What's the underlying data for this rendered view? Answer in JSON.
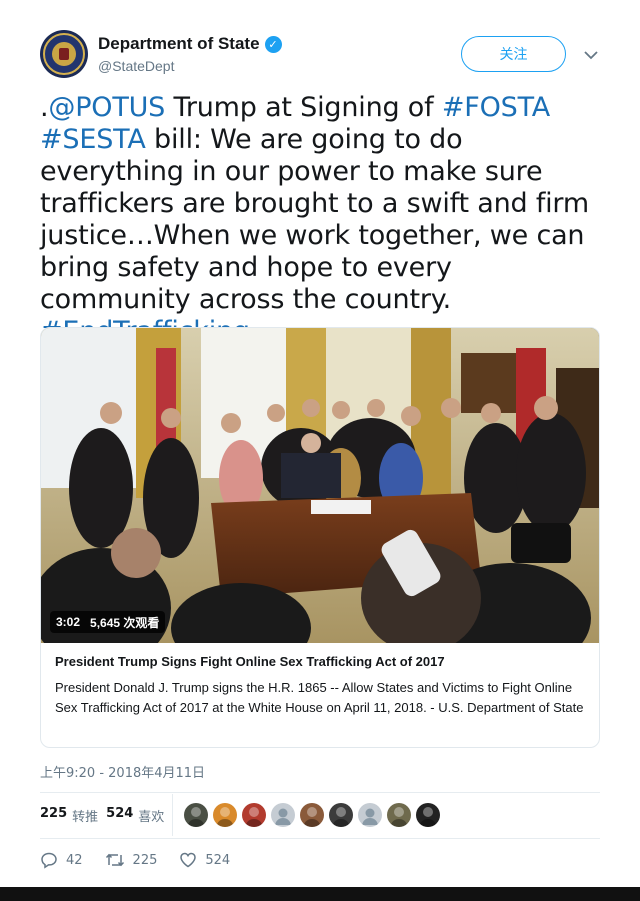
{
  "header": {
    "display_name": "Department of State",
    "handle": "@StateDept",
    "follow_label": "关注",
    "verified_icon": "verified-badge-icon",
    "avatar_icon": "state-department-seal"
  },
  "tweet": {
    "segments": [
      {
        "text": ".",
        "link": false
      },
      {
        "text": "@POTUS",
        "link": true
      },
      {
        "text": " Trump at Signing of ",
        "link": false
      },
      {
        "text": "#FOSTA",
        "link": true
      },
      {
        "text": " ",
        "link": false
      },
      {
        "text": "#SESTA",
        "link": true
      },
      {
        "text": " bill: We are going to do everything in our power to make sure traffickers are brought to a swift and firm justice…When we work together, we can bring safety and hope to every community across the country. ",
        "link": false
      },
      {
        "text": "#EndTrafficking",
        "link": true
      }
    ]
  },
  "card": {
    "video_duration": "3:02",
    "view_count": "5,645 次观看",
    "title": "President Trump Signs Fight Online Sex Trafficking Act of 2017",
    "description": "President Donald J. Trump signs the H.R. 1865 -- Allow States and Victims to Fight Online Sex Trafficking Act of 2017 at the White House on April 11, 2018. - U.S. Department of State"
  },
  "meta": {
    "timestamp": "上午9:20 - 2018年4月11日",
    "retweets_count": "225",
    "retweets_label": "转推",
    "likes_count": "524",
    "likes_label": "喜欢"
  },
  "likers": [
    {
      "icon": "liker-avatar-1",
      "color": "#4a4f44"
    },
    {
      "icon": "liker-avatar-2",
      "color": "#d98a2b"
    },
    {
      "icon": "liker-avatar-3",
      "color": "#b23b2e"
    },
    {
      "icon": "default-avatar-icon",
      "color": "#c5ccd3"
    },
    {
      "icon": "liker-avatar-5",
      "color": "#8a5a3a"
    },
    {
      "icon": "liker-avatar-6",
      "color": "#3b3b3b"
    },
    {
      "icon": "default-avatar-icon",
      "color": "#c5ccd3"
    },
    {
      "icon": "liker-avatar-8",
      "color": "#6f6a4d"
    },
    {
      "icon": "liker-avatar-9",
      "color": "#222222"
    }
  ],
  "actions": {
    "reply_count": "42",
    "retweet_count": "225",
    "like_count": "524"
  },
  "colors": {
    "accent": "#1da1f2",
    "link": "#1b6fb6",
    "muted": "#657786"
  }
}
